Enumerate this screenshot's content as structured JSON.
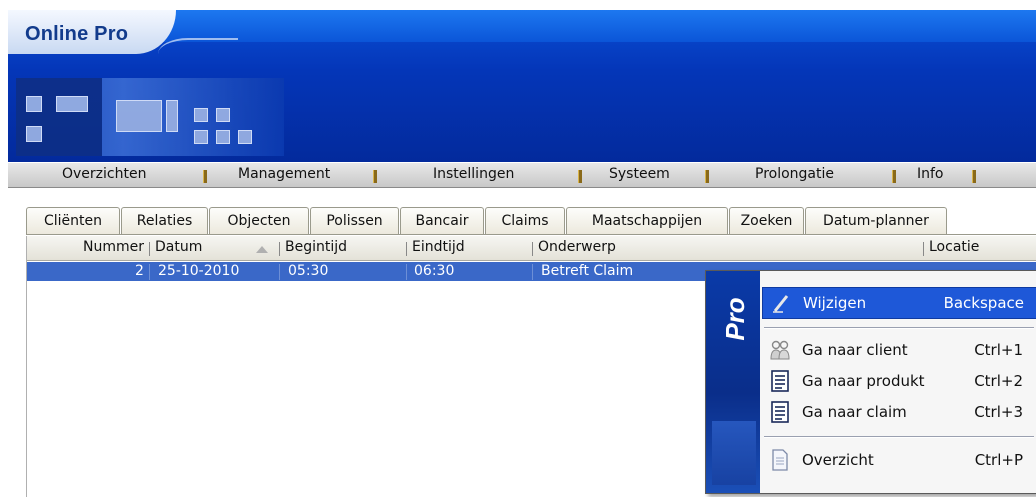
{
  "app": {
    "title": "Online Pro"
  },
  "menubar": {
    "items": [
      "Overzichten",
      "Management",
      "Instellingen",
      "Systeem",
      "Prolongatie",
      "Info"
    ]
  },
  "tabs": [
    "Cliënten",
    "Relaties",
    "Objecten",
    "Polissen",
    "Bancair",
    "Claims",
    "Maatschappijen",
    "Zoeken",
    "Datum-planner"
  ],
  "grid": {
    "columns": [
      "Nummer",
      "Datum",
      "Begintijd",
      "Eindtijd",
      "Onderwerp",
      "Locatie"
    ],
    "sorted_column": "Datum",
    "rows": [
      {
        "nummer": "2",
        "datum": "25-10-2010",
        "begintijd": "05:30",
        "eindtijd": "06:30",
        "onderwerp": "Betreft Claim",
        "locatie": "",
        "selected": true
      }
    ]
  },
  "context_menu": {
    "strip_label": "Pro",
    "items": [
      {
        "label": "Wijzigen",
        "shortcut": "Backspace",
        "icon": "pencil-icon",
        "highlighted": true
      },
      {
        "label": "Ga naar client",
        "shortcut": "Ctrl+1",
        "icon": "users-icon"
      },
      {
        "label": "Ga naar produkt",
        "shortcut": "Ctrl+2",
        "icon": "document-list-icon"
      },
      {
        "label": "Ga naar claim",
        "shortcut": "Ctrl+3",
        "icon": "document-list-icon"
      },
      {
        "label": "Overzicht",
        "shortcut": "Ctrl+P",
        "icon": "document-icon"
      }
    ]
  },
  "colors": {
    "banner": "#0436b8",
    "selection": "#3a68c8",
    "menu_highlight": "#1e58d8"
  }
}
